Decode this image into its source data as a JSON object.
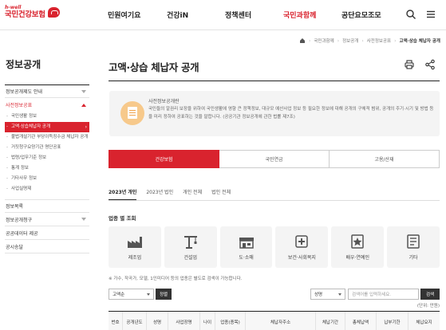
{
  "header": {
    "logo_sub": "h-well",
    "logo_main": "국민건강보험",
    "nav": [
      {
        "label": "민원여기요"
      },
      {
        "label": "건강iN"
      },
      {
        "label": "정책센터"
      },
      {
        "label": "국민과함께"
      },
      {
        "label": "공단요모조모"
      }
    ],
    "active_nav": "국민과함께",
    "icons": [
      "search-icon",
      "menu-icon"
    ]
  },
  "breadcrumb": [
    "국민과함께",
    "정보공개",
    "사전정보공표",
    "고액·상습 체납자 공개"
  ],
  "sidebar": {
    "title": "정보공개",
    "items": [
      {
        "label": "정보공개제도 안내",
        "type": "top"
      },
      {
        "label": "사전정보공표",
        "type": "top-open"
      },
      {
        "label": "국민생활 정보",
        "type": "sub"
      },
      {
        "label": "고액·상습체납자 공개",
        "type": "sub-active"
      },
      {
        "label": "불법개설기관 부당이득징수금 체납자 공개",
        "type": "sub"
      },
      {
        "label": "거짓청구요양기관 명단공표",
        "type": "sub"
      },
      {
        "label": "법령/업무기준 정보",
        "type": "sub"
      },
      {
        "label": "통계 정보",
        "type": "sub"
      },
      {
        "label": "기타사무 정보",
        "type": "sub"
      },
      {
        "label": "사업실명제",
        "type": "sub"
      },
      {
        "label": "정보목록",
        "type": "plain"
      },
      {
        "label": "정보공개청구",
        "type": "top"
      },
      {
        "label": "공공데이터 제공",
        "type": "plain"
      },
      {
        "label": "공시송달",
        "type": "plain"
      }
    ]
  },
  "page": {
    "title": "고액·상습 체납자 공개",
    "icons": [
      "print-icon",
      "share-icon"
    ]
  },
  "info": {
    "heading": "사전정보공개란",
    "text": "국민들의 알권리 보장을 위하여 국민생활에 영향 큰 정책정보, 대규모 예산사업 정보 등 필요한 정보에 대해 공개의 구체적 범위, 공개의 주기·시기 및 방법 등을 미리 정하여 공표하는 것을 말합니다. (공공기관 정보공개에 관한 법률 제7조)"
  },
  "tabs": [
    "건강보험",
    "국민연금",
    "고용/산재"
  ],
  "active_tab": "건강보험",
  "subtabs": [
    "2023년 개인",
    "2023년 법인",
    "개인 전체",
    "법인 전체"
  ],
  "active_subtab": "2023년 개인",
  "section_title": "업종 별 조회",
  "categories": [
    {
      "label": "제조업",
      "icon": "factory-icon"
    },
    {
      "label": "건설업",
      "icon": "crane-icon"
    },
    {
      "label": "도·소매",
      "icon": "store-icon"
    },
    {
      "label": "보건·사회복지",
      "icon": "health-cross-icon"
    },
    {
      "label": "배우·연예인",
      "icon": "star-icon"
    },
    {
      "label": "기타",
      "icon": "misc-icon"
    }
  ],
  "note": "※ 가수, 작곡가, 모델, 1인미디어 등의 업종은 별도로 검색이 가능합니다.",
  "filter": {
    "sort_value": "고액순",
    "sort_button": "정렬",
    "field_value": "성명",
    "search_placeholder": "검색어를 입력하세요.",
    "search_button": "검색",
    "unit": "(단위: 만원)"
  },
  "table": {
    "columns": [
      "번호",
      "공개년도",
      "성명",
      "사업장명",
      "나이",
      "업종(종목)",
      "체납자주소",
      "체납기간",
      "총체납액",
      "납부기한",
      "체납요지"
    ]
  }
}
